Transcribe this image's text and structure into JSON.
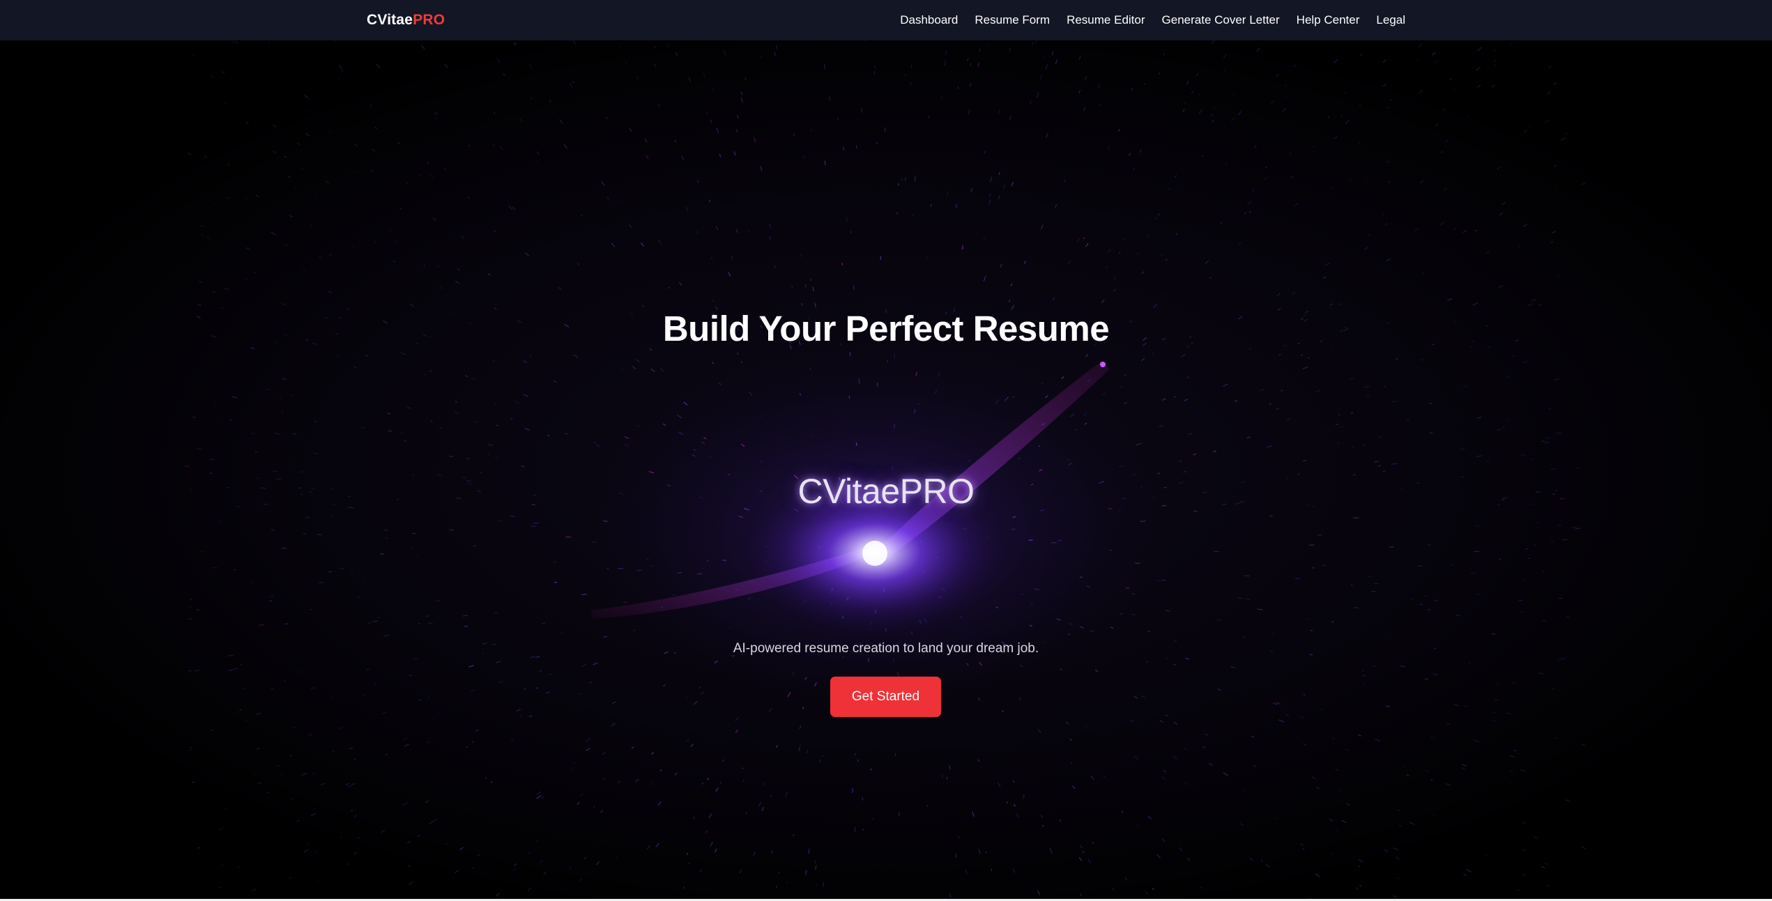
{
  "nav": {
    "brand": {
      "prefix": "CVitae",
      "suffix": "PRO"
    },
    "links": [
      "Dashboard",
      "Resume Form",
      "Resume Editor",
      "Generate Cover Letter",
      "Help Center",
      "Legal"
    ]
  },
  "hero": {
    "title": "Build Your Perfect Resume",
    "logo_text": "CVitaePRO",
    "tagline": "AI-powered resume creation to land your dream job.",
    "cta_label": "Get Started"
  },
  "colors": {
    "navbar_bg": "#131624",
    "brand_accent": "#ef3b3b",
    "cta_bg": "#ef3138",
    "page_bg": "#000000",
    "particle_violet": "#8a4dff",
    "particle_magenta": "#c026d3"
  }
}
